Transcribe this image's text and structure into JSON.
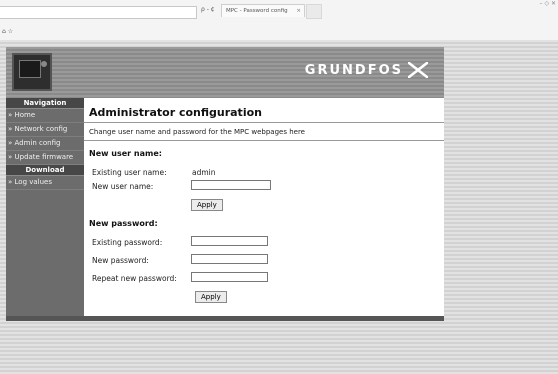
{
  "browser": {
    "address_icons": "ρ - ¢",
    "tab_title": "MPC - Password config",
    "tab_close": "×",
    "favbar_icons": "⌂ ☆",
    "window_icons": "– ◇ ✕"
  },
  "header": {
    "logo_text": "GRUNDFOS"
  },
  "sidebar": {
    "navigation_heading": "Navigation",
    "nav_items": [
      "» Home",
      "» Network config",
      "» Admin config",
      "» Update firmware"
    ],
    "download_heading": "Download",
    "download_items": [
      "» Log values"
    ]
  },
  "main": {
    "title": "Administrator configuration",
    "description": "Change user name and password for the MPC webpages here",
    "username_section": {
      "heading": "New user name:",
      "existing_label": "Existing user name:",
      "existing_value": "admin",
      "new_label": "New user name:",
      "new_value": "",
      "apply_label": "Apply"
    },
    "password_section": {
      "heading": "New password:",
      "existing_label": "Existing password:",
      "new_label": "New password:",
      "repeat_label": "Repeat new password:",
      "apply_label": "Apply"
    }
  }
}
